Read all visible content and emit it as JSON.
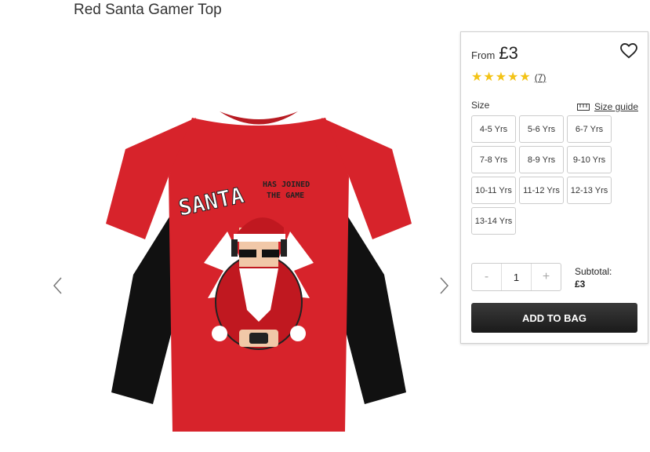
{
  "product": {
    "title": "Red Santa Gamer Top"
  },
  "gallery": {
    "prev_icon": "chevron-left-icon",
    "next_icon": "chevron-right-icon",
    "print": {
      "line1": "SANTA",
      "line2": "HAS JOINED",
      "line3": "THE GAME"
    }
  },
  "purchase": {
    "from_label": "From",
    "price": "£3",
    "wishlist_icon": "heart-icon",
    "rating_stars": 5,
    "review_count": "(7)",
    "size_label": "Size",
    "size_guide_label": "Size guide",
    "sizes": [
      "4-5 Yrs",
      "5-6 Yrs",
      "6-7 Yrs",
      "7-8 Yrs",
      "8-9 Yrs",
      "9-10 Yrs",
      "10-11 Yrs",
      "11-12 Yrs",
      "12-13 Yrs",
      "13-14 Yrs"
    ],
    "quantity": {
      "minus": "-",
      "value": "1",
      "plus": "+"
    },
    "subtotal_label": "Subtotal:",
    "subtotal_value": "£3",
    "add_to_bag": "ADD TO BAG"
  },
  "colors": {
    "accent_star": "#f3c316",
    "button_bg": "#222222",
    "tshirt_red": "#d7232b"
  }
}
